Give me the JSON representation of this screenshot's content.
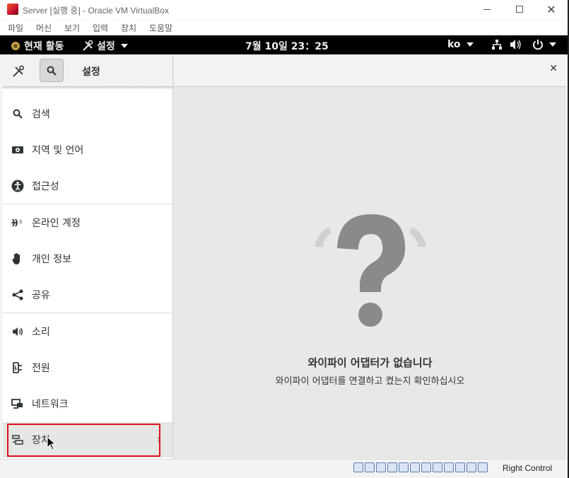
{
  "window": {
    "title": "Server [실행 중] - Oracle VM VirtualBox",
    "controls": [
      "minimize",
      "maximize",
      "close"
    ]
  },
  "menubar": {
    "items": [
      "파일",
      "머신",
      "보기",
      "입력",
      "장치",
      "도움말"
    ]
  },
  "topbar": {
    "activities": "현재 활동",
    "app_menu": "설정",
    "clock": "7월 10일  23：25",
    "lang": "ko"
  },
  "settings": {
    "header_title": "설정",
    "sidebar": [
      {
        "label": "검색",
        "icon": "search-icon"
      },
      {
        "label": "지역 및 언어",
        "icon": "region-icon"
      },
      {
        "label": "접근성",
        "icon": "accessibility-icon"
      },
      {
        "label": "온라인 계정",
        "icon": "online-accounts-icon"
      },
      {
        "label": "개인 정보",
        "icon": "privacy-hand-icon"
      },
      {
        "label": "공유",
        "icon": "share-icon"
      },
      {
        "label": "소리",
        "icon": "speaker-icon"
      },
      {
        "label": "전원",
        "icon": "power-plug-icon"
      },
      {
        "label": "네트워크",
        "icon": "network-icon"
      },
      {
        "label": "장치",
        "icon": "devices-icon"
      }
    ],
    "empty_state": {
      "title": "와이파이 어댑터가 없습니다",
      "subtitle": "와이파이 어댑터를 연결하고 켰는지 확인하십시오"
    }
  },
  "statusbar": {
    "host_key": "Right Control"
  },
  "colors": {
    "highlight_box": "#e0101c",
    "topbar_bg": "#000000",
    "empty_icon": "#8a8a8a"
  }
}
